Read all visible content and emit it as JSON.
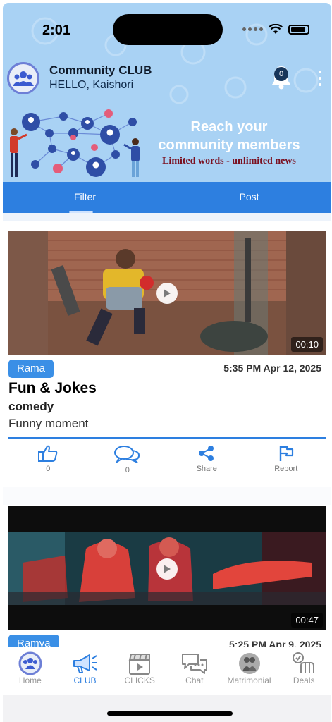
{
  "status_bar": {
    "time": "2:01"
  },
  "header": {
    "app_title": "Community CLUB",
    "greeting": "HELLO, Kaishori",
    "notification_count": "0"
  },
  "banner": {
    "headline_line1": "Reach  your",
    "headline_line2": "community members",
    "tagline": "Limited words - unlimited news"
  },
  "tabs": [
    {
      "label": "Filter",
      "active": true
    },
    {
      "label": "Post",
      "active": false
    }
  ],
  "posts": [
    {
      "author": "Rama",
      "datetime": "5:35 PM Apr 12, 2025",
      "duration": "00:10",
      "title": "Fun & Jokes",
      "category": "comedy",
      "description": "Funny moment",
      "likes": "0",
      "comments": "0",
      "share_label": "Share",
      "report_label": "Report"
    },
    {
      "author": "Ramya",
      "datetime": "5:25 PM Apr 9, 2025",
      "duration": "00:47"
    }
  ],
  "bottom_nav": [
    {
      "label": "Home",
      "icon": "home-community-icon",
      "active": false
    },
    {
      "label": "CLUB",
      "icon": "megaphone-icon",
      "active": true
    },
    {
      "label": "CLICKS",
      "icon": "clapperboard-icon",
      "active": false
    },
    {
      "label": "Chat",
      "icon": "chat-bubbles-icon",
      "active": false
    },
    {
      "label": "Matrimonial",
      "icon": "couple-icon",
      "active": false
    },
    {
      "label": "Deals",
      "icon": "deal-handshake-icon",
      "active": false
    }
  ],
  "colors": {
    "primary": "#2d7fe0",
    "banner_bg": "#a9d2f4",
    "author_badge": "#3a8fe6",
    "tagline": "#7a1020"
  }
}
